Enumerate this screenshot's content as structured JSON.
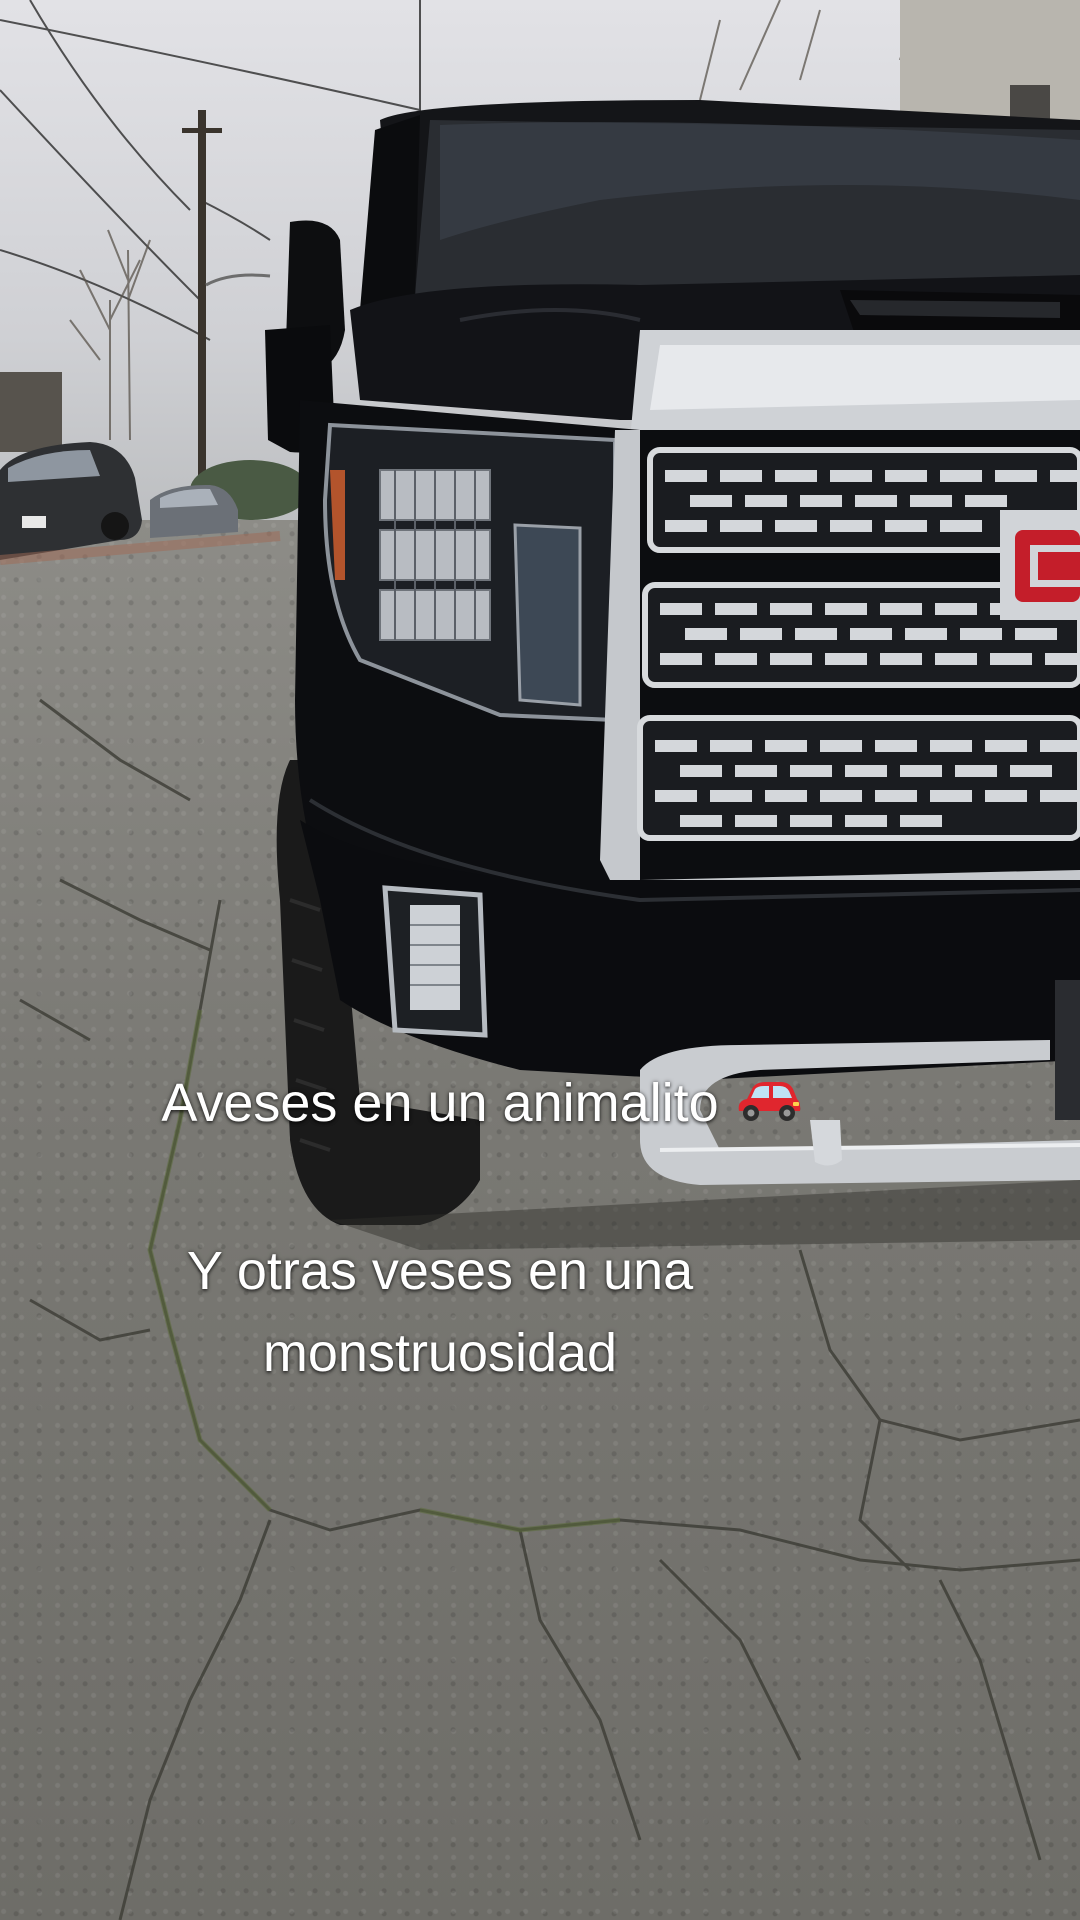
{
  "captions": {
    "line1": "Aveses en un animalito",
    "line2": "Y otras veses en una",
    "line3": "monstruosidad"
  },
  "icons": {
    "caption_emoji": "red-car-icon"
  },
  "colors": {
    "truck_body": "#0c0d10",
    "chrome": "#c9ccd0",
    "emblem_red": "#c41e2a",
    "emoji_red": "#e0262e"
  }
}
